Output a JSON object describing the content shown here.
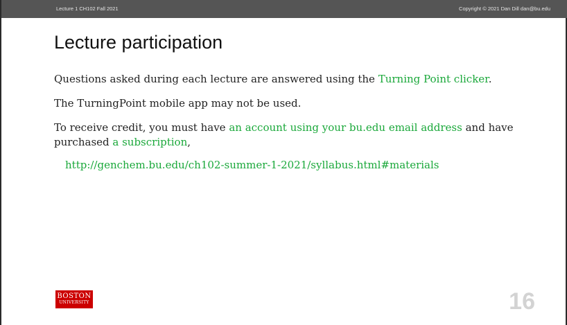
{
  "header": {
    "left": "Lecture 1 CH102 Fall 2021",
    "right": "Copyright © 2021 Dan Dill dan@bu.edu"
  },
  "title": "Lecture participation",
  "paragraphs": {
    "p1_text": "Questions asked during each lecture are answered using the ",
    "p1_link": "Turning Point clicker",
    "p1_end": ".",
    "p2": "The TurningPoint mobile app may not be used.",
    "p3_text1": "To receive credit, you must have ",
    "p3_link1": "an account using your bu.edu email address",
    "p3_text2": " and have purchased ",
    "p3_link2": "a subscription",
    "p3_end": ","
  },
  "url": "http://genchem.bu.edu/ch102-summer-1-2021/syllabus.html#materials",
  "logo": {
    "line1": "BOSTON",
    "line2": "UNIVERSITY"
  },
  "page_number": "16",
  "colors": {
    "header_bg": "#555555",
    "link": "#1aa83a",
    "logo_bg": "#cc0000",
    "page_number": "#d3d3d3"
  }
}
